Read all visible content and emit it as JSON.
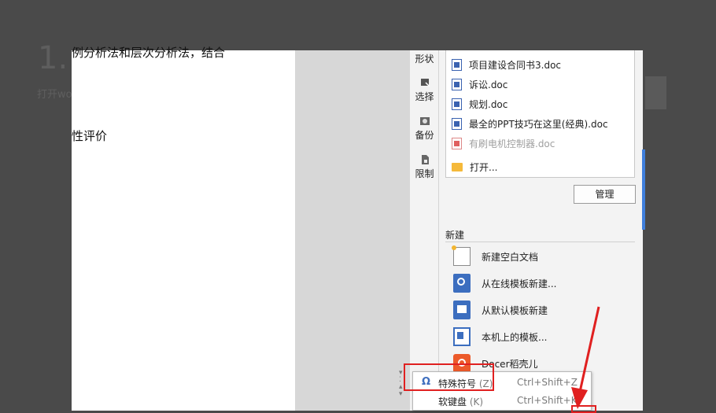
{
  "background": {
    "big_text": "1.",
    "small_text": "打开wo"
  },
  "document": {
    "line1": "例分析法和层次分析法，结合",
    "line2": "性评价"
  },
  "side_strip": {
    "items": [
      {
        "label": "形状",
        "icon": "shape-icon"
      },
      {
        "label": "选择",
        "icon": "select-icon"
      },
      {
        "label": "备份",
        "icon": "backup-icon"
      },
      {
        "label": "限制",
        "icon": "restrict-icon"
      }
    ]
  },
  "recent": {
    "items": [
      {
        "name": "项目建设合同书3.doc",
        "icon": "word-doc-icon",
        "dim": false
      },
      {
        "name": "诉讼.doc",
        "icon": "word-doc-icon",
        "dim": false
      },
      {
        "name": "规划.doc",
        "icon": "word-doc-icon",
        "dim": false
      },
      {
        "name": "最全的PPT技巧在这里(经典).doc",
        "icon": "word-doc-icon",
        "dim": false
      },
      {
        "name": "有刷电机控制器.doc",
        "icon": "word-doc-icon-missing",
        "dim": true
      }
    ],
    "open_label": "打开...",
    "manage_label": "管理"
  },
  "new_section": {
    "title": "新建",
    "items": [
      {
        "label": "新建空白文档",
        "icon": "blank-doc-icon"
      },
      {
        "label": "从在线模板新建...",
        "icon": "online-template-icon"
      },
      {
        "label": "从默认模板新建",
        "icon": "default-template-icon"
      },
      {
        "label": "本机上的模板...",
        "icon": "local-template-icon"
      },
      {
        "label": "Docer稻壳儿",
        "icon": "docer-icon"
      }
    ]
  },
  "context_menu": {
    "items": [
      {
        "label": "特殊符号",
        "accel": "(Z)",
        "shortcut": "Ctrl+Shift+Z",
        "icon": "omega-icon"
      },
      {
        "label": "软键盘",
        "accel": "(K)",
        "shortcut": "Ctrl+Shift+K",
        "icon": ""
      }
    ]
  },
  "colors": {
    "accent_blue": "#3f7fdc",
    "highlight_red": "#e02020",
    "docer_orange": "#ec5a2a"
  }
}
